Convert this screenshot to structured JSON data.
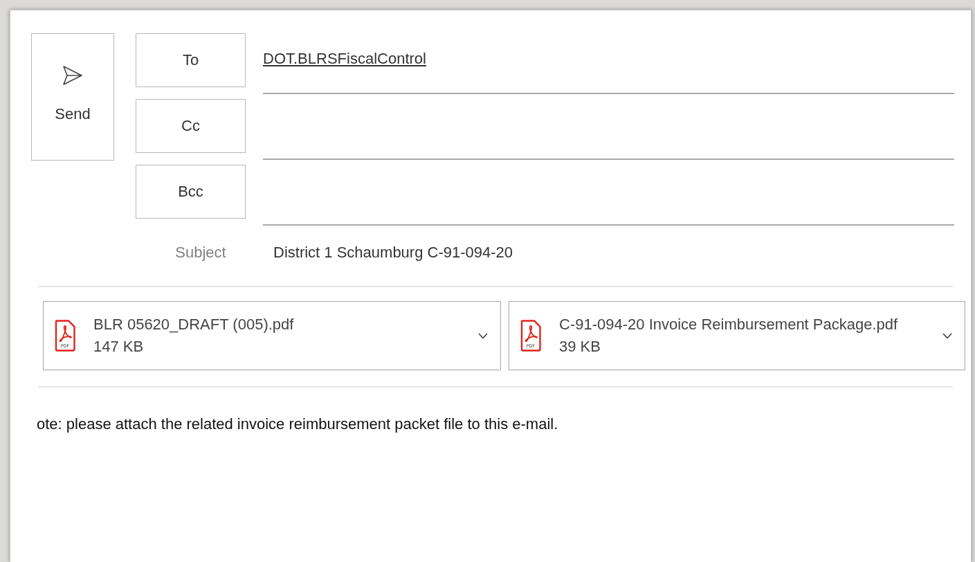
{
  "send_button": {
    "label": "Send"
  },
  "recipients": [
    {
      "label": "To",
      "value": "DOT.BLRSFiscalControl"
    },
    {
      "label": "Cc"
    },
    {
      "label": "Bcc"
    }
  ],
  "subject": {
    "label": "Subject",
    "value": "District 1 Schaumburg C-91-094-20"
  },
  "attachments": [
    {
      "name": "BLR 05620_DRAFT (005).pdf",
      "size": "147 KB",
      "kind": "pdf",
      "icon_label": "PDF"
    },
    {
      "name": "C-91-094-20 Invoice Reimbursement Package.pdf",
      "size": "39 KB",
      "kind": "pdf",
      "icon_label": "PDF"
    }
  ],
  "body": {
    "text": "ote: please attach the related invoice reimbursement packet file to this e-mail."
  }
}
